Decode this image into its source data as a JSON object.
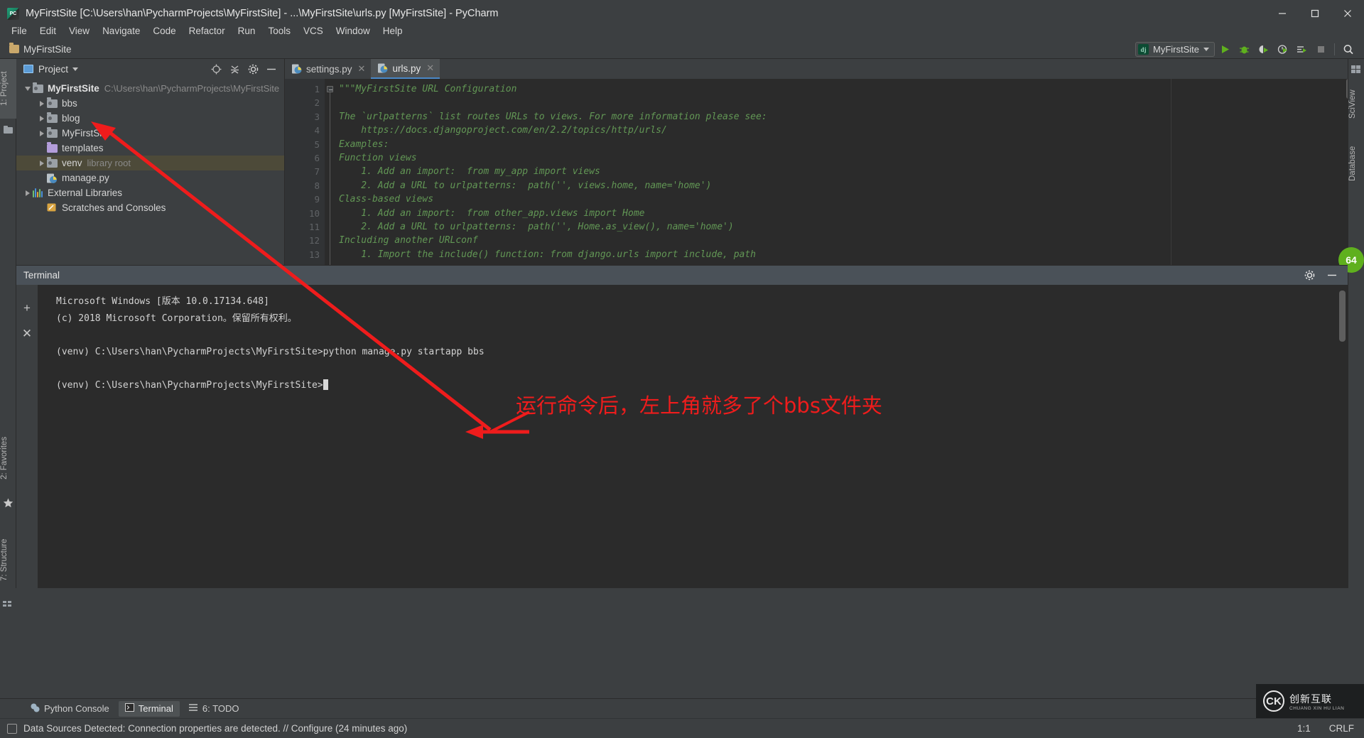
{
  "window": {
    "title": "MyFirstSite [C:\\Users\\han\\PycharmProjects\\MyFirstSite] - ...\\MyFirstSite\\urls.py [MyFirstSite] - PyCharm",
    "app_icon": "pycharm-icon",
    "minimize": "—",
    "maximize": "▢",
    "close": "✕"
  },
  "menubar": {
    "items": [
      {
        "label": "File"
      },
      {
        "label": "Edit"
      },
      {
        "label": "View"
      },
      {
        "label": "Navigate"
      },
      {
        "label": "Code"
      },
      {
        "label": "Refactor"
      },
      {
        "label": "Run"
      },
      {
        "label": "Tools"
      },
      {
        "label": "VCS"
      },
      {
        "label": "Window"
      },
      {
        "label": "Help"
      }
    ]
  },
  "navbar": {
    "breadcrumb": "MyFirstSite",
    "run_config": {
      "badge": "dj",
      "name": "MyFirstSite"
    },
    "buttons": [
      {
        "name": "run-button",
        "title": "Run"
      },
      {
        "name": "debug-button",
        "title": "Debug"
      },
      {
        "name": "coverage-button",
        "title": "Run with Coverage"
      },
      {
        "name": "profile-button",
        "title": "Profile"
      },
      {
        "name": "run-tests-button",
        "title": "Run tests"
      },
      {
        "name": "stop-button",
        "title": "Stop"
      },
      {
        "name": "search-everywhere-button",
        "title": "Search Everywhere"
      }
    ]
  },
  "left_strip": {
    "tabs": [
      {
        "label": "1: Project",
        "selected": true
      },
      {
        "label": "2: Favorites",
        "selected": false
      },
      {
        "label": "7: Structure",
        "selected": false
      }
    ]
  },
  "right_strip": {
    "tabs": [
      {
        "label": "SciView",
        "selected": false
      },
      {
        "label": "Database",
        "selected": false
      }
    ]
  },
  "project_panel": {
    "title": "Project",
    "actions": [
      "target-icon",
      "collapse-all-icon",
      "settings-icon",
      "hide-icon"
    ],
    "tree": [
      {
        "depth": 0,
        "twisty": "open",
        "icon": "folder-grey",
        "label": "MyFirstSite",
        "bold": true,
        "dim": "C:\\Users\\han\\PycharmProjects\\MyFirstSite",
        "selected": false
      },
      {
        "depth": 1,
        "twisty": "closed",
        "icon": "folder-grey",
        "label": "bbs",
        "bold": false,
        "dim": "",
        "selected": false
      },
      {
        "depth": 1,
        "twisty": "closed",
        "icon": "folder-grey",
        "label": "blog",
        "bold": false,
        "dim": "",
        "selected": false
      },
      {
        "depth": 1,
        "twisty": "closed",
        "icon": "folder-grey",
        "label": "MyFirstSite",
        "bold": false,
        "dim": "",
        "selected": false
      },
      {
        "depth": 1,
        "twisty": "none",
        "icon": "folder-purple",
        "label": "templates",
        "bold": false,
        "dim": "",
        "selected": false
      },
      {
        "depth": 1,
        "twisty": "closed",
        "icon": "folder-grey",
        "label": "venv",
        "bold": false,
        "dim": "library root",
        "selected": true
      },
      {
        "depth": 1,
        "twisty": "none",
        "icon": "python-file",
        "label": "manage.py",
        "bold": false,
        "dim": "",
        "selected": false
      },
      {
        "depth": 0,
        "twisty": "closed",
        "icon": "libraries",
        "label": "External Libraries",
        "bold": false,
        "dim": "",
        "selected": false
      },
      {
        "depth": 0,
        "twisty": "none",
        "icon": "scratches",
        "label": "Scratches and Consoles",
        "bold": false,
        "dim": "",
        "selected": false
      }
    ]
  },
  "editor": {
    "tabs": [
      {
        "label": "settings.py",
        "active": false,
        "close": "✕"
      },
      {
        "label": "urls.py",
        "active": true,
        "close": "✕"
      }
    ],
    "lines": [
      {
        "no": "1",
        "text": "\"\"\"MyFirstSite URL Configuration"
      },
      {
        "no": "2",
        "text": ""
      },
      {
        "no": "3",
        "text": "The `urlpatterns` list routes URLs to views. For more information please see:"
      },
      {
        "no": "4",
        "text": "    https://docs.djangoproject.com/en/2.2/topics/http/urls/"
      },
      {
        "no": "5",
        "text": "Examples:"
      },
      {
        "no": "6",
        "text": "Function views"
      },
      {
        "no": "7",
        "text": "    1. Add an import:  from my_app import views"
      },
      {
        "no": "8",
        "text": "    2. Add a URL to urlpatterns:  path('', views.home, name='home')"
      },
      {
        "no": "9",
        "text": "Class-based views"
      },
      {
        "no": "10",
        "text": "    1. Add an import:  from other_app.views import Home"
      },
      {
        "no": "11",
        "text": "    2. Add a URL to urlpatterns:  path('', Home.as_view(), name='home')"
      },
      {
        "no": "12",
        "text": "Including another URLconf"
      },
      {
        "no": "13",
        "text": "    1. Import the include() function: from django.urls import include, path"
      }
    ]
  },
  "terminal": {
    "title": "Terminal",
    "side_buttons": [
      {
        "name": "new-session-button",
        "glyph": "+"
      },
      {
        "name": "close-session-button",
        "glyph": "✕"
      }
    ],
    "header_actions": [
      "settings-icon",
      "hide-icon"
    ],
    "lines": [
      "Microsoft Windows [版本 10.0.17134.648]",
      "(c) 2018 Microsoft Corporation。保留所有权利。",
      "",
      "(venv) C:\\Users\\han\\PycharmProjects\\MyFirstSite>python manage.py startapp bbs",
      "",
      "(venv) C:\\Users\\han\\PycharmProjects\\MyFirstSite>"
    ]
  },
  "annotation": {
    "text": "运行命令后，左上角就多了个bbs文件夹",
    "color": "#ef1c1c"
  },
  "bottom_tabs": [
    {
      "label": "Python Console",
      "icon": "python-icon",
      "selected": false
    },
    {
      "label": "Terminal",
      "icon": "terminal-icon",
      "selected": true
    },
    {
      "label": "6: TODO",
      "icon": "todo-icon",
      "selected": false
    }
  ],
  "statusbar": {
    "message": "Data Sources Detected: Connection properties are detected. // Configure (24 minutes ago)",
    "caret": "1:1",
    "line_separator": "CRLF"
  },
  "watermark": {
    "mark": "CK",
    "line1": "创新互联",
    "line2": "CHUANG XIN HU LIAN"
  },
  "notification_bubble": {
    "count": "64"
  },
  "colors": {
    "accent_blue": "#4a88c7",
    "panel_bg": "#3c3f41",
    "editor_bg": "#2b2b2b",
    "comment_green": "#629755",
    "selection_gold": "#4d4a39",
    "annotation_red": "#ef1c1c"
  }
}
